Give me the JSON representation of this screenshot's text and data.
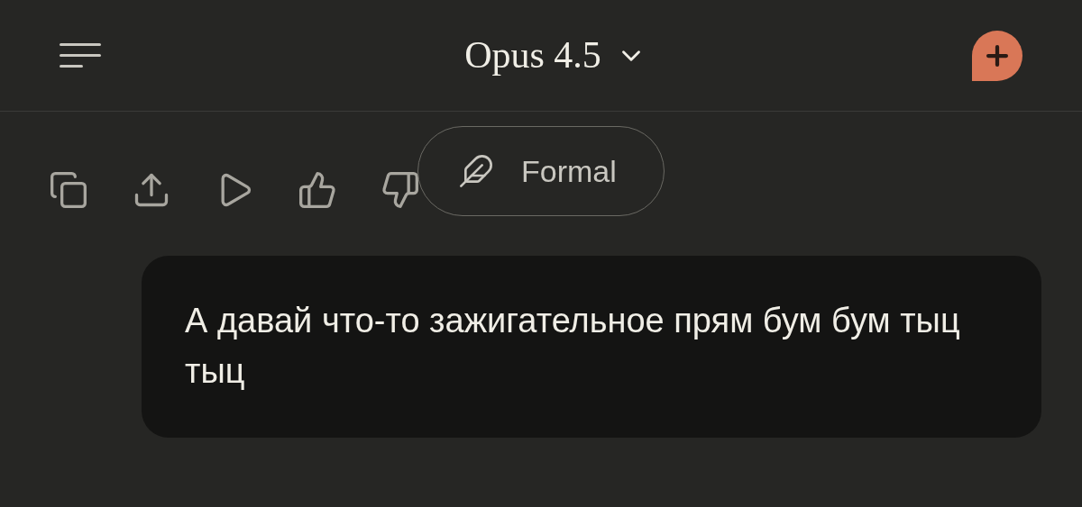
{
  "header": {
    "model_title": "Opus 4.5"
  },
  "message_actions": {
    "style_chip": {
      "label": "Formal"
    }
  },
  "user_message": {
    "text": "А давай что-то зажигательное прям бум бум тыц тыц"
  }
}
